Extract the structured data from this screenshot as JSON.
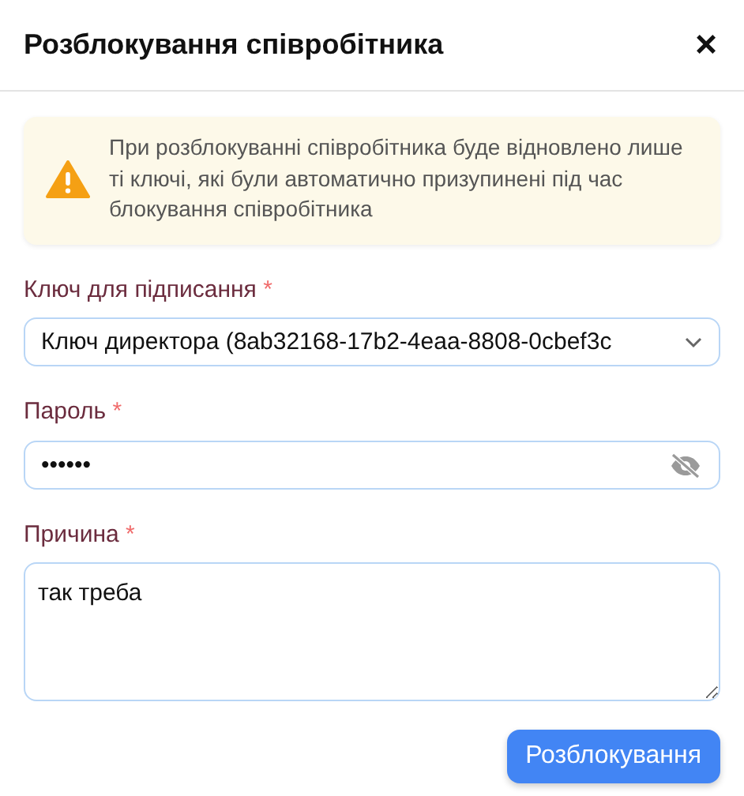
{
  "dialog": {
    "title": "Розблокування співробітника",
    "close": "×"
  },
  "alert": {
    "text": "При розблокуванні співробітника буде відновлено лише ті ключі, які були автоматично призупинені під час блокування співробітника"
  },
  "fields": [
    {
      "kind": "select",
      "label": "Ключ для підписання",
      "required_mark": "*",
      "value": "Ключ директора (8ab32168-17b2-4eaa-8808-0cbef3c"
    },
    {
      "kind": "password",
      "label": "Пароль",
      "required_mark": "*",
      "value": "••••••"
    },
    {
      "kind": "textarea",
      "label": "Причина",
      "required_mark": "*",
      "value": "так треба"
    }
  ],
  "buttons": [
    {
      "label": "Розблокування"
    }
  ]
}
